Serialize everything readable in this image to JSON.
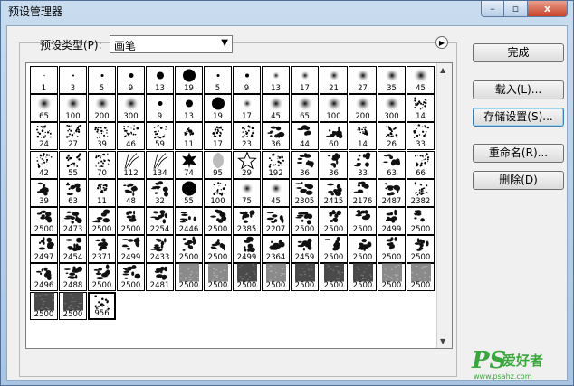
{
  "window": {
    "title": "预设管理器",
    "min_symbol": "–",
    "max_symbol": "▫",
    "close_symbol": "x"
  },
  "preset_type": {
    "label": "预设类型(P):",
    "value": "画笔",
    "arrow": "▼",
    "menu_arrow": "▶"
  },
  "buttons": {
    "done": "完成",
    "load": "载入(L)...",
    "save": "存储设置(S)...",
    "rename": "重命名(R)...",
    "delete": "删除(D)"
  },
  "brushes": [
    {
      "n": "1",
      "k": "dot",
      "s": 1
    },
    {
      "n": "3",
      "k": "dot",
      "s": 2
    },
    {
      "n": "5",
      "k": "dot",
      "s": 3
    },
    {
      "n": "9",
      "k": "dot",
      "s": 5
    },
    {
      "n": "13",
      "k": "dot",
      "s": 8
    },
    {
      "n": "19",
      "k": "dot",
      "s": 14
    },
    {
      "n": "5",
      "k": "dot",
      "s": 3
    },
    {
      "n": "9",
      "k": "dot",
      "s": 4
    },
    {
      "n": "13",
      "k": "soft",
      "s": 7
    },
    {
      "n": "17",
      "k": "soft",
      "s": 9
    },
    {
      "n": "21",
      "k": "soft",
      "s": 11
    },
    {
      "n": "27",
      "k": "soft",
      "s": 13
    },
    {
      "n": "35",
      "k": "soft",
      "s": 14
    },
    {
      "n": "45",
      "k": "soft",
      "s": 16
    },
    {
      "n": "65",
      "k": "soft",
      "s": 16
    },
    {
      "n": "100",
      "k": "soft",
      "s": 16
    },
    {
      "n": "200",
      "k": "soft",
      "s": 16
    },
    {
      "n": "300",
      "k": "soft",
      "s": 16
    },
    {
      "n": "9",
      "k": "dot",
      "s": 5
    },
    {
      "n": "13",
      "k": "dot",
      "s": 8
    },
    {
      "n": "19",
      "k": "dot",
      "s": 14
    },
    {
      "n": "17",
      "k": "soft",
      "s": 9
    },
    {
      "n": "45",
      "k": "soft",
      "s": 15
    },
    {
      "n": "65",
      "k": "soft",
      "s": 16
    },
    {
      "n": "100",
      "k": "soft",
      "s": 16
    },
    {
      "n": "200",
      "k": "soft",
      "s": 16
    },
    {
      "n": "300",
      "k": "soft",
      "s": 16
    },
    {
      "n": "14",
      "k": "spray",
      "s": 14
    },
    {
      "n": "24",
      "k": "spray",
      "s": 16
    },
    {
      "n": "27",
      "k": "spray",
      "s": 16
    },
    {
      "n": "39",
      "k": "spray",
      "s": 16
    },
    {
      "n": "46",
      "k": "spray",
      "s": 16
    },
    {
      "n": "59",
      "k": "spray",
      "s": 16
    },
    {
      "n": "11",
      "k": "spray",
      "s": 10
    },
    {
      "n": "17",
      "k": "spray",
      "s": 12
    },
    {
      "n": "23",
      "k": "spray",
      "s": 14
    },
    {
      "n": "36",
      "k": "blot",
      "s": 16
    },
    {
      "n": "44",
      "k": "blot",
      "s": 16
    },
    {
      "n": "60",
      "k": "blot",
      "s": 16
    },
    {
      "n": "14",
      "k": "spray",
      "s": 12
    },
    {
      "n": "26",
      "k": "spray",
      "s": 14
    },
    {
      "n": "33",
      "k": "spray",
      "s": 16
    },
    {
      "n": "42",
      "k": "spray",
      "s": 16
    },
    {
      "n": "55",
      "k": "spray",
      "s": 16
    },
    {
      "n": "70",
      "k": "spray",
      "s": 16
    },
    {
      "n": "112",
      "k": "grass",
      "s": 18
    },
    {
      "n": "134",
      "k": "grass",
      "s": 18
    },
    {
      "n": "74",
      "k": "leaf",
      "s": 16
    },
    {
      "n": "95",
      "k": "leafgray",
      "s": 16
    },
    {
      "n": "29",
      "k": "star",
      "s": 16
    },
    {
      "n": "192",
      "k": "spray",
      "s": 16
    },
    {
      "n": "36",
      "k": "blot",
      "s": 16
    },
    {
      "n": "36",
      "k": "blot",
      "s": 16
    },
    {
      "n": "33",
      "k": "blot",
      "s": 16
    },
    {
      "n": "63",
      "k": "blot",
      "s": 16
    },
    {
      "n": "66",
      "k": "spray",
      "s": 16
    },
    {
      "n": "39",
      "k": "blot",
      "s": 16
    },
    {
      "n": "63",
      "k": "blot",
      "s": 16
    },
    {
      "n": "11",
      "k": "spray",
      "s": 10
    },
    {
      "n": "48",
      "k": "blot",
      "s": 16
    },
    {
      "n": "32",
      "k": "blot",
      "s": 16
    },
    {
      "n": "55",
      "k": "dot",
      "s": 16
    },
    {
      "n": "100",
      "k": "spray",
      "s": 16
    },
    {
      "n": "75",
      "k": "soft",
      "s": 12
    },
    {
      "n": "45",
      "k": "soft",
      "s": 12
    },
    {
      "n": "2305",
      "k": "blot",
      "s": 16
    },
    {
      "n": "2415",
      "k": "blot",
      "s": 16
    },
    {
      "n": "2176",
      "k": "blot",
      "s": 16
    },
    {
      "n": "2487",
      "k": "blot",
      "s": 16
    },
    {
      "n": "2382",
      "k": "spray",
      "s": 16
    },
    {
      "n": "2500",
      "k": "blot",
      "s": 16
    },
    {
      "n": "2473",
      "k": "blot",
      "s": 16
    },
    {
      "n": "2500",
      "k": "blot",
      "s": 16
    },
    {
      "n": "2500",
      "k": "blot",
      "s": 16
    },
    {
      "n": "2254",
      "k": "blot",
      "s": 16
    },
    {
      "n": "2446",
      "k": "blot",
      "s": 16
    },
    {
      "n": "2500",
      "k": "blot",
      "s": 16
    },
    {
      "n": "2385",
      "k": "blot",
      "s": 16
    },
    {
      "n": "2207",
      "k": "blot",
      "s": 16
    },
    {
      "n": "2500",
      "k": "blot",
      "s": 16
    },
    {
      "n": "2500",
      "k": "blot",
      "s": 16
    },
    {
      "n": "2500",
      "k": "blot",
      "s": 16
    },
    {
      "n": "2499",
      "k": "blot",
      "s": 16
    },
    {
      "n": "2500",
      "k": "blot",
      "s": 16
    },
    {
      "n": "2497",
      "k": "blot",
      "s": 16
    },
    {
      "n": "2454",
      "k": "blot",
      "s": 16
    },
    {
      "n": "2371",
      "k": "blot",
      "s": 16
    },
    {
      "n": "2499",
      "k": "blot",
      "s": 16
    },
    {
      "n": "2433",
      "k": "blot",
      "s": 16
    },
    {
      "n": "2500",
      "k": "blot",
      "s": 16
    },
    {
      "n": "2500",
      "k": "blot",
      "s": 16
    },
    {
      "n": "2499",
      "k": "blot",
      "s": 16
    },
    {
      "n": "2364",
      "k": "blot",
      "s": 16
    },
    {
      "n": "2459",
      "k": "blot",
      "s": 16
    },
    {
      "n": "2500",
      "k": "blot",
      "s": 16
    },
    {
      "n": "2500",
      "k": "blot",
      "s": 16
    },
    {
      "n": "2500",
      "k": "blot",
      "s": 16
    },
    {
      "n": "2500",
      "k": "blot",
      "s": 16
    },
    {
      "n": "2496",
      "k": "blot",
      "s": 16
    },
    {
      "n": "2488",
      "k": "blot",
      "s": 16
    },
    {
      "n": "2500",
      "k": "blot",
      "s": 16
    },
    {
      "n": "2500",
      "k": "blot",
      "s": 16
    },
    {
      "n": "2481",
      "k": "blot",
      "s": 16
    },
    {
      "n": "2500",
      "k": "tex",
      "s": 20
    },
    {
      "n": "2500",
      "k": "tex",
      "s": 20
    },
    {
      "n": "2500",
      "k": "texdark",
      "s": 20
    },
    {
      "n": "2500",
      "k": "tex",
      "s": 20
    },
    {
      "n": "2500",
      "k": "texdark",
      "s": 20
    },
    {
      "n": "2500",
      "k": "texdark",
      "s": 20
    },
    {
      "n": "2500",
      "k": "texdark",
      "s": 20
    },
    {
      "n": "2500",
      "k": "tex",
      "s": 20
    },
    {
      "n": "2500",
      "k": "tex",
      "s": 20
    },
    {
      "n": "2500",
      "k": "texdark",
      "s": 20
    },
    {
      "n": "2500",
      "k": "texdark",
      "s": 20
    },
    {
      "n": "956",
      "k": "spray",
      "s": 16,
      "selected": true
    }
  ],
  "watermark": {
    "brand": "PS",
    "text": "爱好者",
    "url": "www.psahz.com"
  }
}
